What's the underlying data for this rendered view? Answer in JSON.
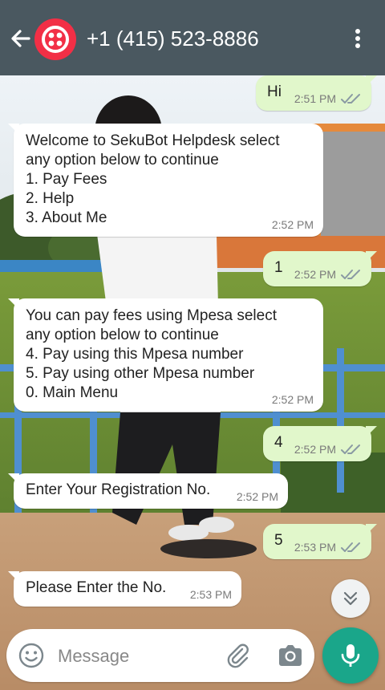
{
  "header": {
    "contact_name": "+1 (415) 523-8886",
    "back_icon": "arrow-left-icon",
    "avatar_icon": "twilio-logo-icon",
    "menu_icon": "more-vert-icon",
    "color": "#4a5860"
  },
  "messages": [
    {
      "direction": "out",
      "text": "Hi",
      "time": "2:51 PM",
      "status": "read"
    },
    {
      "direction": "in",
      "text": "Welcome to SekuBot Helpdesk select\nany option below to continue\n1. Pay Fees\n2. Help\n3. About Me",
      "time": "2:52 PM"
    },
    {
      "direction": "out",
      "text": "1",
      "time": "2:52 PM",
      "status": "read"
    },
    {
      "direction": "in",
      "text": "You can pay fees using Mpesa select\nany option below to continue\n4. Pay using this Mpesa number\n5. Pay using other Mpesa number\n0. Main Menu",
      "time": "2:52 PM"
    },
    {
      "direction": "out",
      "text": "4",
      "time": "2:52 PM",
      "status": "read"
    },
    {
      "direction": "in",
      "text": "Enter Your Registration No.",
      "time": "2:52 PM"
    },
    {
      "direction": "out",
      "text": "5",
      "time": "2:53 PM",
      "status": "read"
    },
    {
      "direction": "in",
      "text": "Please Enter the No.",
      "time": "2:53 PM"
    }
  ],
  "composer": {
    "placeholder": "Message",
    "emoji_icon": "emoji-icon",
    "attach_icon": "paperclip-icon",
    "camera_icon": "camera-icon",
    "mic_icon": "mic-icon",
    "scroll_icon": "double-chevron-down-icon"
  },
  "colors": {
    "incoming_bubble": "#ffffff",
    "outgoing_bubble": "#e1f7cb",
    "read_ticks": "#8a9aa3",
    "accent": "#1aa68a"
  }
}
